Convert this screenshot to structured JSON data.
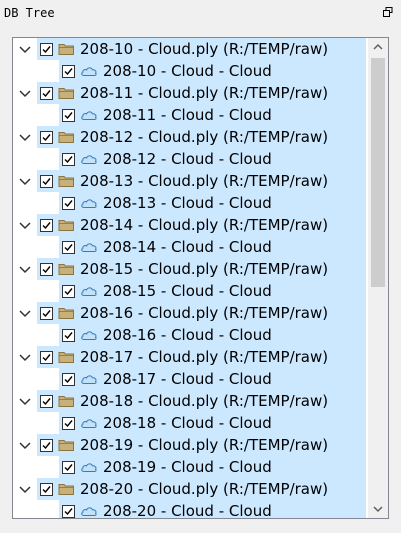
{
  "panel": {
    "title": "DB Tree"
  },
  "tree": {
    "items": [
      {
        "file": "208-10 - Cloud.ply (R:/TEMP/raw)",
        "cloud": "208-10 - Cloud - Cloud"
      },
      {
        "file": "208-11 - Cloud.ply (R:/TEMP/raw)",
        "cloud": "208-11 - Cloud - Cloud"
      },
      {
        "file": "208-12 - Cloud.ply (R:/TEMP/raw)",
        "cloud": "208-12 - Cloud - Cloud"
      },
      {
        "file": "208-13 - Cloud.ply (R:/TEMP/raw)",
        "cloud": "208-13 - Cloud - Cloud"
      },
      {
        "file": "208-14 - Cloud.ply (R:/TEMP/raw)",
        "cloud": "208-14 - Cloud - Cloud"
      },
      {
        "file": "208-15 - Cloud.ply (R:/TEMP/raw)",
        "cloud": "208-15 - Cloud - Cloud"
      },
      {
        "file": "208-16 - Cloud.ply (R:/TEMP/raw)",
        "cloud": "208-16 - Cloud - Cloud"
      },
      {
        "file": "208-17 - Cloud.ply (R:/TEMP/raw)",
        "cloud": "208-17 - Cloud - Cloud"
      },
      {
        "file": "208-18 - Cloud.ply (R:/TEMP/raw)",
        "cloud": "208-18 - Cloud - Cloud"
      },
      {
        "file": "208-19 - Cloud.ply (R:/TEMP/raw)",
        "cloud": "208-19 - Cloud - Cloud"
      },
      {
        "file": "208-20 - Cloud.ply (R:/TEMP/raw)",
        "cloud": "208-20 - Cloud - Cloud"
      }
    ]
  },
  "colors": {
    "selection": "#cce8ff",
    "folder": "#b89d62",
    "cloud_fill": "#bfe0f7",
    "cloud_stroke": "#3a7bb5"
  },
  "icons": {
    "expander": "chevron-down-icon",
    "checkbox": "checkmark-icon",
    "file": "folder-icon",
    "cloud": "cloud-icon",
    "float": "float-window-icon"
  },
  "scrollbar": {
    "position_fraction": 0.0,
    "visible_fraction": 0.5
  }
}
